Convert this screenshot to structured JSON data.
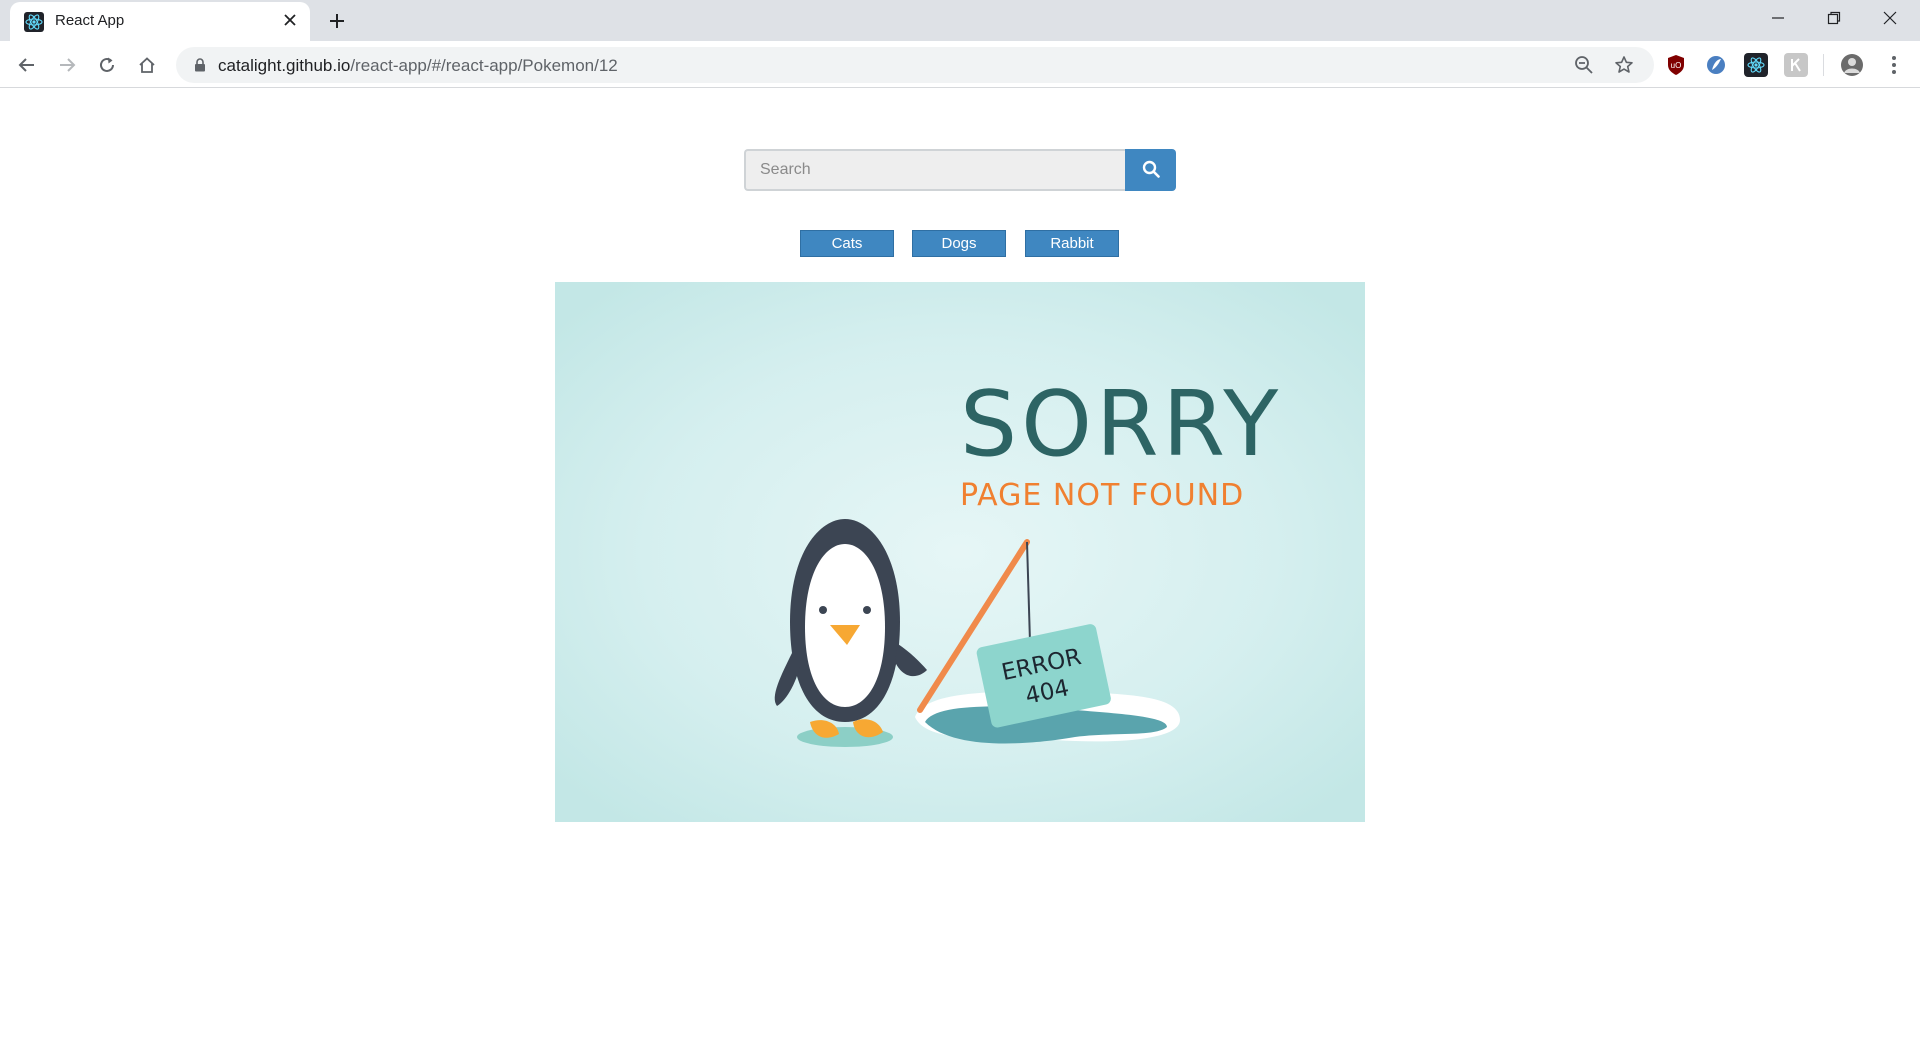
{
  "browser": {
    "tab_title": "React App",
    "url_host": "catalight.github.io",
    "url_path": "/react-app/#/react-app/Pokemon/12",
    "icons": [
      "react-favicon-icon",
      "close-icon",
      "plus-icon",
      "minimize-icon",
      "restore-icon",
      "window-close-icon",
      "back-icon",
      "forward-icon",
      "reload-icon",
      "home-icon",
      "lock-icon",
      "zoom-out-icon",
      "star-icon",
      "ublock-extension-icon",
      "shield-extension-icon",
      "react-devtools-icon",
      "generic-extension-icon",
      "profile-avatar-icon",
      "menu-dots-icon"
    ]
  },
  "search": {
    "placeholder": "Search",
    "icon": "search-icon"
  },
  "filters": {
    "buttons": [
      {
        "label": "Cats"
      },
      {
        "label": "Dogs"
      },
      {
        "label": "Rabbit"
      }
    ]
  },
  "hero": {
    "heading": "SORRY",
    "subheading": "PAGE NOT FOUND",
    "sign_line1": "ERROR",
    "sign_line2": "404"
  },
  "colors": {
    "accent": "#3f87c1",
    "hero_bg": "#c6e8e8",
    "heading": "#2d6464",
    "subheading": "#f08030"
  }
}
